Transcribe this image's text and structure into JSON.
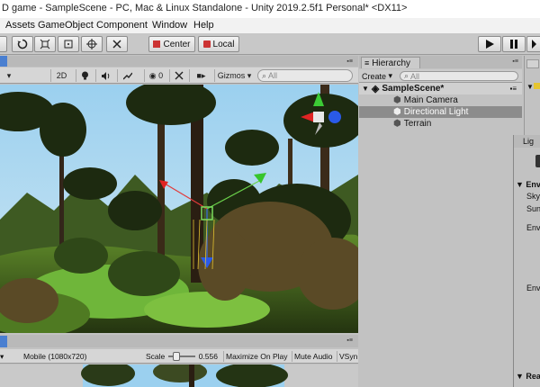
{
  "window": {
    "title": "D game - SampleScene - PC, Mac & Linux Standalone - Unity 2019.2.5f1 Personal* <DX11>"
  },
  "menu": [
    "Assets",
    "GameObject",
    "Component",
    "Window",
    "Help"
  ],
  "toolbar": {
    "center_label": "Center",
    "local_label": "Local"
  },
  "scene": {
    "mode_2d": "2D",
    "fx_count": "0",
    "gizmos_label": "Gizmos",
    "search_placeholder": "All"
  },
  "hierarchy": {
    "tab_label": "Hierarchy",
    "create_label": "Create",
    "search_placeholder": "All",
    "scene_name": "SampleScene*",
    "items": [
      "Main Camera",
      "Directional Light",
      "Terrain"
    ]
  },
  "game": {
    "resolution": "Mobile (1080x720)",
    "scale_label": "Scale",
    "scale_value": "0.556",
    "scale_level": 0.2,
    "maximize_label": "Maximize On Play",
    "mute_label": "Mute Audio",
    "vsync_label": "VSyn"
  },
  "inspector": {
    "tab_label": "Lig",
    "rows": [
      "Env",
      "Sky",
      "Sun",
      "Env",
      "Env",
      "Rea"
    ]
  },
  "colors": {
    "selection": "#8c8c8c",
    "panel": "#c2c2c2",
    "sky": "#9fd3f0"
  }
}
